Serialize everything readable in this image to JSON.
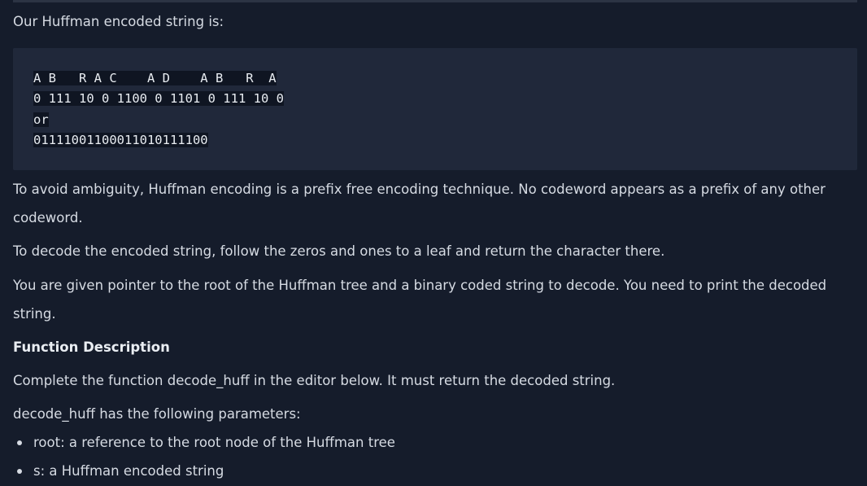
{
  "intro": "Our Huffman encoded string is:",
  "code_block": {
    "letters_line": "A B   R A C    A D    A B   R  A",
    "bits_line": "0 111 10 0 1100 0 1101 0 111 10 0",
    "or_line": "or",
    "full_bits": "01111001100011010111100"
  },
  "paragraphs": {
    "p1_line1": "To avoid ambiguity, Huffman encoding is a prefix free encoding technique. No codeword appears as a prefix of any other",
    "p1_line2": "codeword.",
    "p2": "To decode the encoded string, follow the zeros and ones to a leaf and return the character there.",
    "p3_line1": "You are given pointer to the root of the Huffman tree and a binary coded string to decode. You need to print the decoded",
    "p3_line2": "string."
  },
  "function_description": {
    "heading": "Function Description",
    "text": "Complete the function decode_huff in the editor below. It must return the decoded string.",
    "params_intro": "decode_huff has the following parameters:",
    "params": [
      "root: a reference to the root node of the Huffman tree",
      "s: a Huffman encoded string"
    ]
  }
}
